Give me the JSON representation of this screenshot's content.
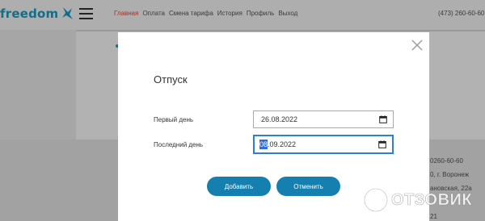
{
  "header": {
    "logo_text": "freedom",
    "nav": [
      {
        "label": "Главная",
        "active": true
      },
      {
        "label": "Оплата",
        "active": false
      },
      {
        "label": "Смена тарифа",
        "active": false
      },
      {
        "label": "История",
        "active": false
      },
      {
        "label": "Профиль",
        "active": false
      },
      {
        "label": "Выход",
        "active": false
      }
    ],
    "phone": "(473) 260-60-60"
  },
  "footer": {
    "lines": [
      "0260-60-60",
      "0, г. Воронеж",
      "ановская, 22а",
      "21"
    ]
  },
  "modal": {
    "title": "Отпуск",
    "first_day_label": "Первый день",
    "first_day_value": "26.08.2022",
    "last_day_label": "Последний день",
    "last_day_value_highlight": "08",
    "last_day_value_rest": ".09.2022",
    "add_button": "Добавить",
    "cancel_button": "Отменить",
    "close_icon": "close-icon",
    "calendar_icon": "calendar-icon"
  },
  "watermark": {
    "text": "ОТЗОВИК"
  },
  "colors": {
    "brand": "#1aa0c7",
    "nav_active": "#e04a3c",
    "button": "#157fb0",
    "focus": "#2e7ed6"
  }
}
